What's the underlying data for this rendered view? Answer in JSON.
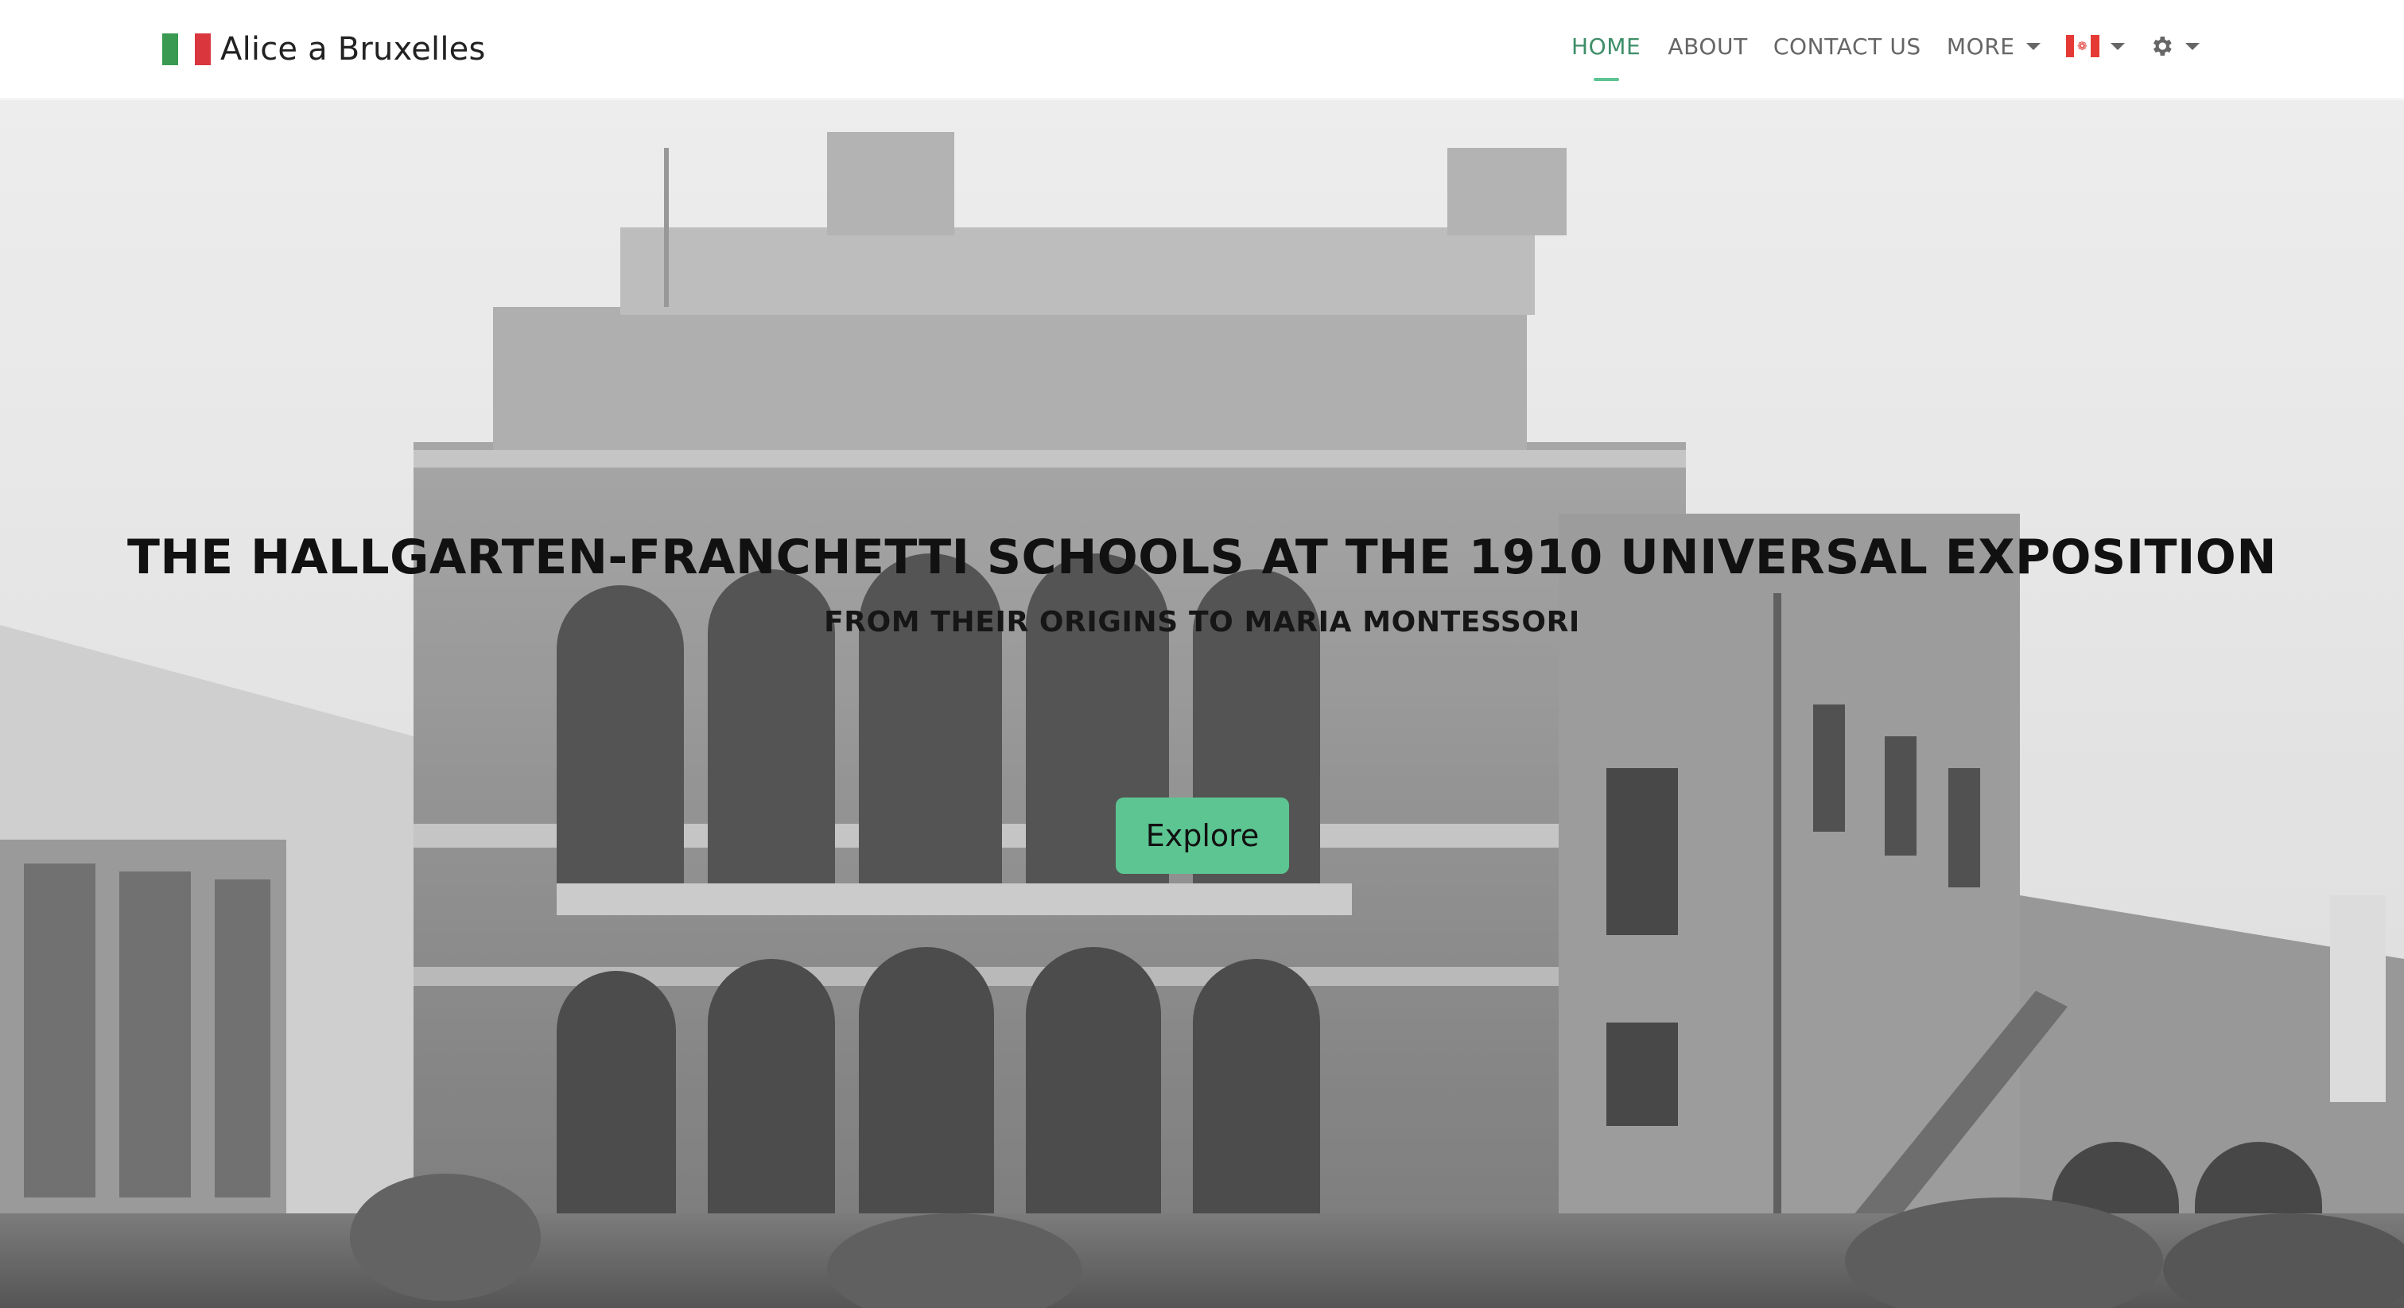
{
  "brand": {
    "name": "Alice a Bruxelles",
    "flag_icon": "italian-flag-icon",
    "flag_colors": [
      "#3a9a52",
      "#ffffff",
      "#d9363e"
    ]
  },
  "nav": {
    "items": [
      {
        "label": "HOME",
        "active": true
      },
      {
        "label": "ABOUT",
        "active": false
      },
      {
        "label": "CONTACT US",
        "active": false
      },
      {
        "label": "MORE",
        "active": false,
        "dropdown": true
      }
    ],
    "language_icon": "canada-flag-icon",
    "settings_icon": "gear-icon",
    "active_color": "#3e8e69",
    "indicator_color": "#5cc592"
  },
  "hero": {
    "title": "THE HALLGARTEN-FRANCHETTI SCHOOLS AT THE 1910 UNIVERSAL EXPOSITION",
    "subtitle": "FROM THEIR ORIGINS TO MARIA MONTESSORI",
    "button_label": "Explore",
    "button_color": "#5cc592"
  }
}
